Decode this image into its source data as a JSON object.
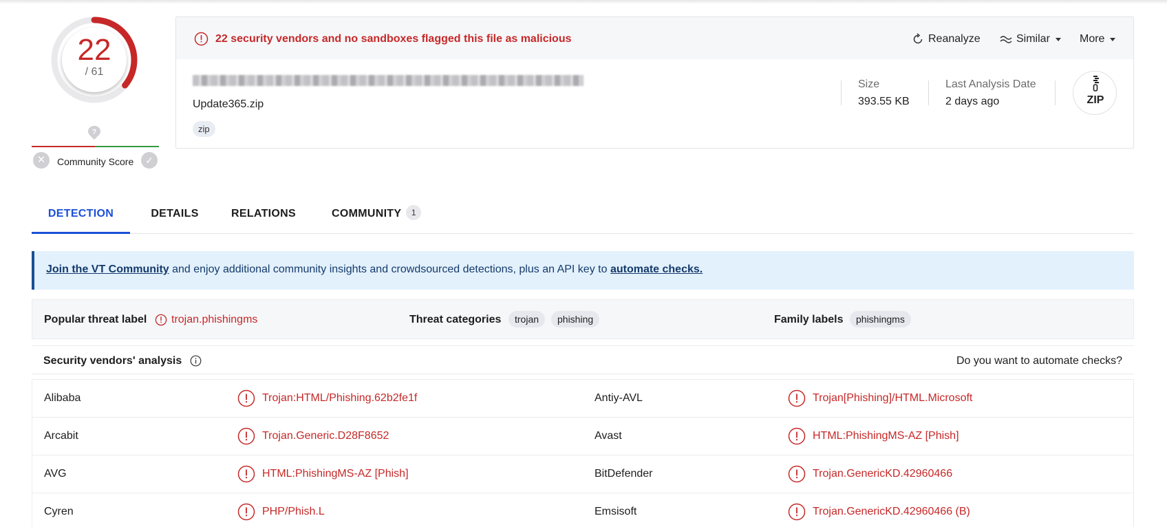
{
  "score": {
    "detections": "22",
    "total": "/ 61",
    "fraction": 0.36,
    "accent_color": "#c62828"
  },
  "community": {
    "label": "Community Score",
    "question_icon": "question-bubble-icon",
    "down_icon": "x-icon",
    "up_icon": "check-icon"
  },
  "alert": {
    "text": "22 security vendors and no sandboxes flagged this file as malicious",
    "icon": "alert-circle-icon"
  },
  "actions": {
    "reanalyze": "Reanalyze",
    "similar": "Similar",
    "more": "More"
  },
  "file": {
    "name": "Update365.zip",
    "tag": "zip",
    "type_label": "ZIP"
  },
  "meta": {
    "size_label": "Size",
    "size_value": "393.55 KB",
    "date_label": "Last Analysis Date",
    "date_value": "2 days ago"
  },
  "tabs": [
    {
      "label": "DETECTION",
      "active": true
    },
    {
      "label": "DETAILS",
      "active": false
    },
    {
      "label": "RELATIONS",
      "active": false
    },
    {
      "label": "COMMUNITY",
      "active": false,
      "badge": "1"
    }
  ],
  "banner": {
    "link1": "Join the VT Community",
    "middle": " and enjoy additional community insights and crowdsourced detections, plus an API key to ",
    "link2": "automate checks."
  },
  "threat": {
    "popular_label": "Popular threat label",
    "popular_value": "trojan.phishingms",
    "categories_label": "Threat categories",
    "categories": [
      "trojan",
      "phishing"
    ],
    "family_label": "Family labels",
    "families": [
      "phishingms"
    ]
  },
  "vendors_header": {
    "title": "Security vendors' analysis",
    "automate": "Do you want to automate checks?"
  },
  "vendors": [
    {
      "left_name": "Alibaba",
      "left_result": "Trojan:HTML/Phishing.62b2fe1f",
      "right_name": "Antiy-AVL",
      "right_result": "Trojan[Phishing]/HTML.Microsoft"
    },
    {
      "left_name": "Arcabit",
      "left_result": "Trojan.Generic.D28F8652",
      "right_name": "Avast",
      "right_result": "HTML:PhishingMS-AZ [Phish]"
    },
    {
      "left_name": "AVG",
      "left_result": "HTML:PhishingMS-AZ [Phish]",
      "right_name": "BitDefender",
      "right_result": "Trojan.GenericKD.42960466"
    },
    {
      "left_name": "Cyren",
      "left_result": "PHP/Phish.L",
      "right_name": "Emsisoft",
      "right_result": "Trojan.GenericKD.42960466 (B)"
    }
  ]
}
